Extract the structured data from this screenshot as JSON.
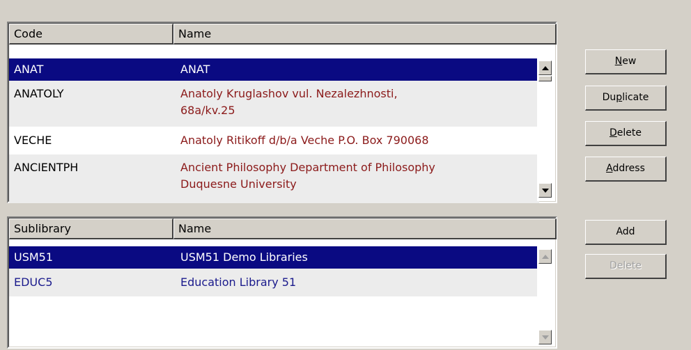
{
  "vendors": {
    "columns": [
      "Code",
      "Name"
    ],
    "rows": [
      {
        "code": "ANAT",
        "name_line1": "ANAT",
        "name_line2": ""
      },
      {
        "code": "ANATOLY",
        "name_line1": "Anatoly Kruglashov vul. Nezalezhnosti,",
        "name_line2": "68a/kv.25"
      },
      {
        "code": "VECHE",
        "name_line1": "Anatoly Ritikoff d/b/a Veche P.O. Box 790068",
        "name_line2": ""
      },
      {
        "code": "ANCIENTPH",
        "name_line1": "Ancient Philosophy Department of Philosophy",
        "name_line2": "Duquesne University"
      }
    ]
  },
  "vendor_buttons": {
    "new_pre": "",
    "new_u": "N",
    "new_post": "ew",
    "duplicate_pre": "Du",
    "duplicate_u": "p",
    "duplicate_post": "licate",
    "delete_pre": "",
    "delete_u": "D",
    "delete_post": "elete",
    "address_pre": "",
    "address_u": "A",
    "address_post": "ddress"
  },
  "sublibraries": {
    "columns": [
      "Sublibrary",
      "Name"
    ],
    "rows": [
      {
        "code": "USM51",
        "name": "USM51 Demo Libraries"
      },
      {
        "code": "EDUC5",
        "name": "Education Library 51"
      }
    ]
  },
  "sublibrary_buttons": {
    "add": "Add",
    "delete": "Delete"
  },
  "colors": {
    "selection": "#0a0a82",
    "name_text": "#8b1a1a",
    "sublib_text": "#1a1a8c"
  }
}
